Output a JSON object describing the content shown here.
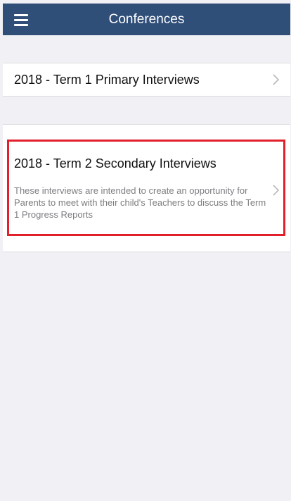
{
  "header": {
    "title": "Conferences",
    "menu_icon": "hamburger-menu-icon",
    "background_color": "#2f4e78"
  },
  "conferences": [
    {
      "title": "2018 - Term 1 Primary Interviews",
      "description": ""
    },
    {
      "title": "2018 - Term 2 Secondary Interviews",
      "description": "These interviews are intended to create an opportunity for Parents to meet with their child's Teachers to discuss the Term 1 Progress Reports",
      "highlighted": true,
      "highlight_color": "#e1202b"
    }
  ],
  "icons": {
    "row_disclosure": "chevron-right-icon"
  }
}
